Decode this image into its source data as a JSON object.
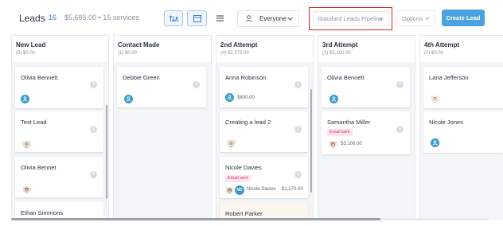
{
  "header": {
    "title": "Leads",
    "count": "16",
    "summary": "$5,685.00 • 15 services",
    "owner_filter": "Everyone",
    "pipeline": "Standard Leads Pipeline",
    "options": "Options",
    "create_button": "Create Lead",
    "sort_icon": "sort-arrows-icon",
    "board_icon": "board-view-icon",
    "list_icon": "list-view-icon"
  },
  "columns": [
    {
      "name": "New Lead",
      "meta": "(5) $0.00",
      "cards": [
        {
          "name": "Olivia Bennett",
          "avatar": "user-avatar-icon"
        },
        {
          "name": "Test Lead",
          "avatar": "photo"
        },
        {
          "name": "Olivia Bennet",
          "avatar": "photo"
        },
        {
          "name": "Ethan Simmons"
        }
      ]
    },
    {
      "name": "Contact Made",
      "meta": "(1) $0.00",
      "cards": [
        {
          "name": "Debbie Green",
          "avatar": "user-avatar-icon"
        }
      ]
    },
    {
      "name": "2nd Attempt",
      "meta": "(4) $2,375.00",
      "cards": [
        {
          "name": "Anna Robinson",
          "avatar": "user-avatar-icon",
          "amount": "$800.00"
        },
        {
          "name": "Creating a lead 2",
          "avatar": "photo"
        },
        {
          "name": "Nicole Davies",
          "badge": "Email sent",
          "owner_initials": "ND",
          "owner_name": "Nicole Davies",
          "amount": "$1,270.00"
        },
        {
          "name": "Robert Parker"
        }
      ]
    },
    {
      "name": "3rd Attempt",
      "meta": "(2) $3,100.00",
      "cards": [
        {
          "name": "Olivia Bennett",
          "avatar": "user-avatar-icon"
        },
        {
          "name": "Samantha Miller",
          "badge": "Email sent",
          "avatar": "photo",
          "amount": "$3,100.00"
        }
      ]
    },
    {
      "name": "4th Attempt",
      "meta": "(2) $0.00",
      "cards": [
        {
          "name": "Lana Jefferson",
          "avatar": "photo"
        },
        {
          "name": "Nicole Jones",
          "avatar": "user-avatar-icon"
        }
      ]
    }
  ],
  "colors": {
    "accent": "#4aa3df",
    "highlight_border": "#e02020",
    "badge_bg": "#fde4ee",
    "badge_text": "#d6336c",
    "avatar": "#3a9bc7"
  }
}
